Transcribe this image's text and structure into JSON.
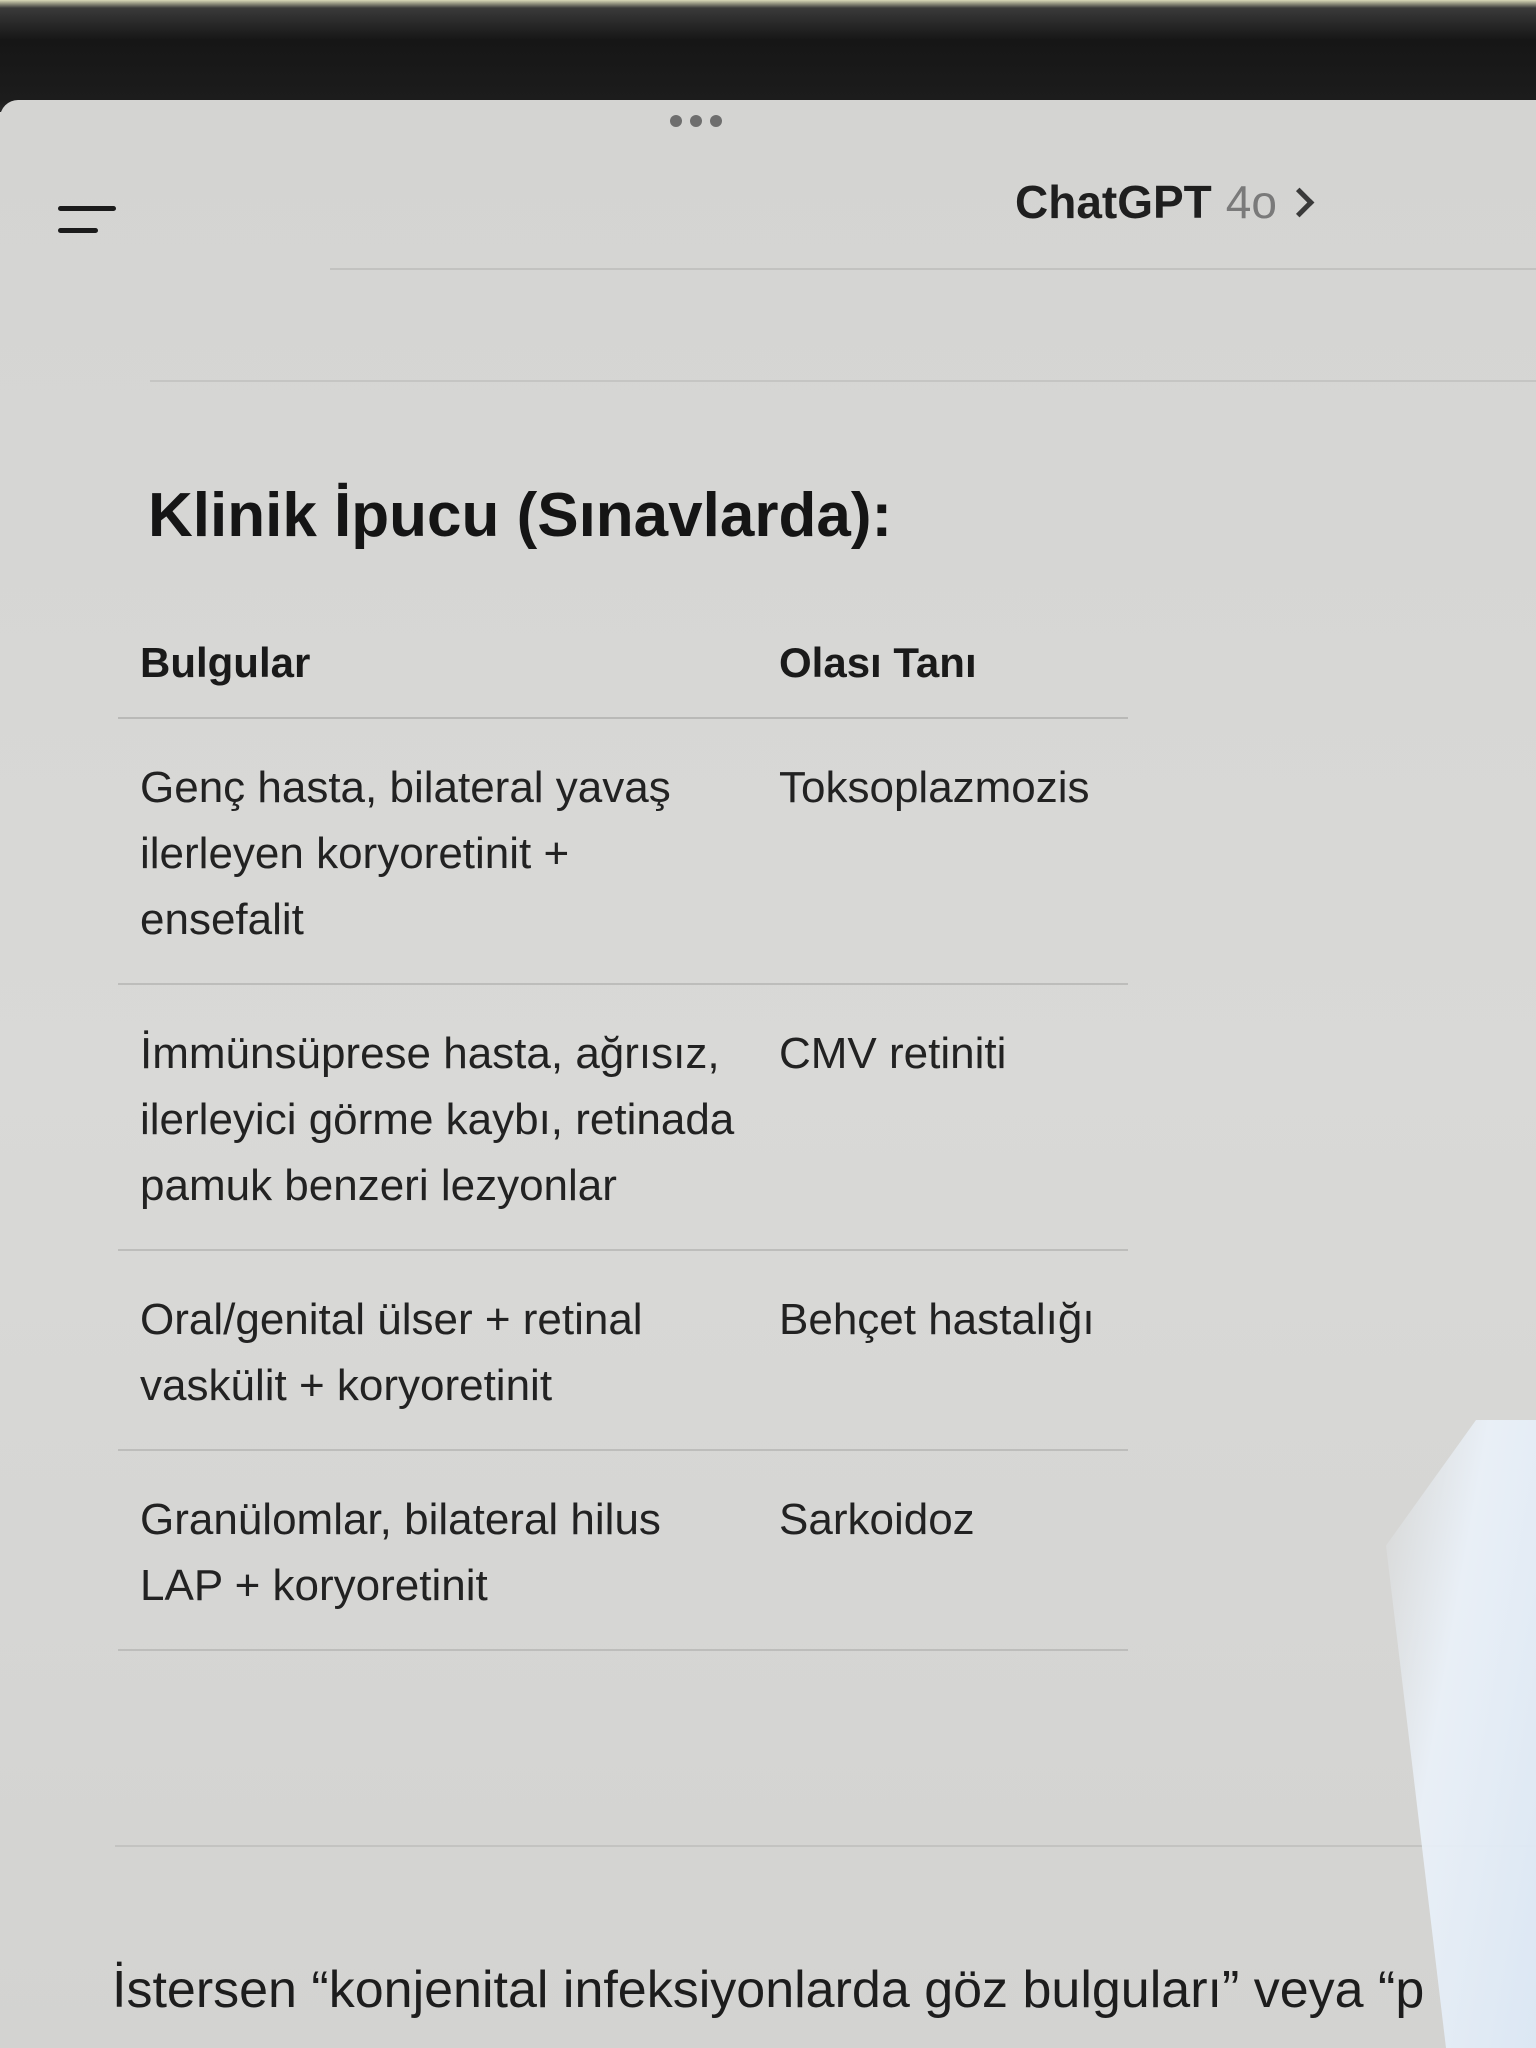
{
  "header": {
    "model_name": "ChatGPT",
    "model_version": "4o",
    "icons": {
      "menu": "hamburger-menu-icon",
      "chevron": "chevron-right-icon",
      "window_more": "more-dots-icon"
    }
  },
  "content": {
    "section_title": "Klinik İpucu (Sınavlarda):",
    "table": {
      "columns": [
        "Bulgular",
        "Olası Tanı"
      ],
      "rows": [
        {
          "findings": "Genç hasta, bilateral yavaş ilerleyen koryoretinit + ensefalit",
          "diagnosis": "Toksoplazmozis"
        },
        {
          "findings": "İmmünsüprese hasta, ağrısız, ilerleyici görme kaybı, retinada pamuk benzeri lezyonlar",
          "diagnosis": "CMV retiniti"
        },
        {
          "findings": "Oral/genital ülser + retinal vaskülit + koryoretinit",
          "diagnosis": "Behçet hastalığı"
        },
        {
          "findings": "Granülomlar, bilateral hilus LAP + koryoretinit",
          "diagnosis": "Sarkoidoz"
        }
      ]
    },
    "footer_text": "İstersen “konjenital infeksiyonlarda göz bulguları” veya “p"
  }
}
